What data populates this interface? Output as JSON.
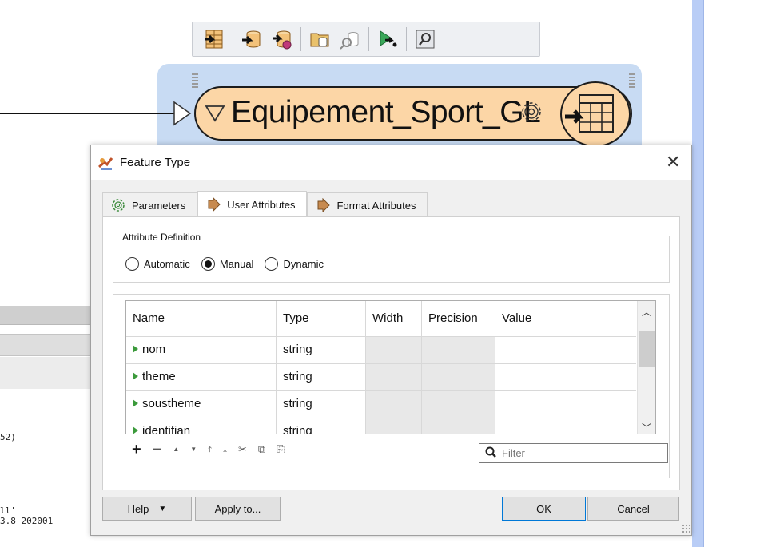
{
  "log": {
    "line1": "52)",
    "line2": "ll'",
    "line3": "3.8 202001"
  },
  "toolbar": {
    "icons": [
      "insert-reader-icon",
      "add-reader-icon",
      "add-writer-icon",
      "open-dataset-icon",
      "inspect-icon",
      "run-icon",
      "zoom-icon"
    ]
  },
  "node": {
    "title": "Equipement_Sport_GL",
    "fill_color": "#fcd6a6",
    "background_color": "#c8dbf3"
  },
  "dialog": {
    "title": "Feature Type",
    "close_glyph": "✕",
    "tabs": [
      {
        "label": "Parameters",
        "active": false
      },
      {
        "label": "User Attributes",
        "active": true
      },
      {
        "label": "Format Attributes",
        "active": false
      }
    ],
    "attribute_definition": {
      "label": "Attribute Definition",
      "options": [
        "Automatic",
        "Manual",
        "Dynamic"
      ],
      "selected": "Manual"
    },
    "table": {
      "columns": [
        "Name",
        "Type",
        "Width",
        "Precision",
        "Value"
      ],
      "rows": [
        {
          "name": "nom",
          "type": "string",
          "width": "",
          "precision": "",
          "value": ""
        },
        {
          "name": "theme",
          "type": "string",
          "width": "",
          "precision": "",
          "value": ""
        },
        {
          "name": "soustheme",
          "type": "string",
          "width": "",
          "precision": "",
          "value": ""
        },
        {
          "name": "identifian",
          "type": "string",
          "width": "",
          "precision": "",
          "value": ""
        }
      ]
    },
    "tools": {
      "add": "+",
      "remove": "−",
      "move_up": "▲",
      "move_down": "▼",
      "move_top": "⤒",
      "move_bottom": "⤓",
      "cut": "✂",
      "copy": "⧉",
      "paste": "⎘"
    },
    "filter": {
      "placeholder": "Filter",
      "value": ""
    },
    "buttons": {
      "help": "Help",
      "apply_to": "Apply to...",
      "ok": "OK",
      "cancel": "Cancel"
    }
  },
  "colors": {
    "accent": "#0078d7",
    "strip": "#b9cdf6",
    "attr_arrow": "#3b9a3b"
  }
}
